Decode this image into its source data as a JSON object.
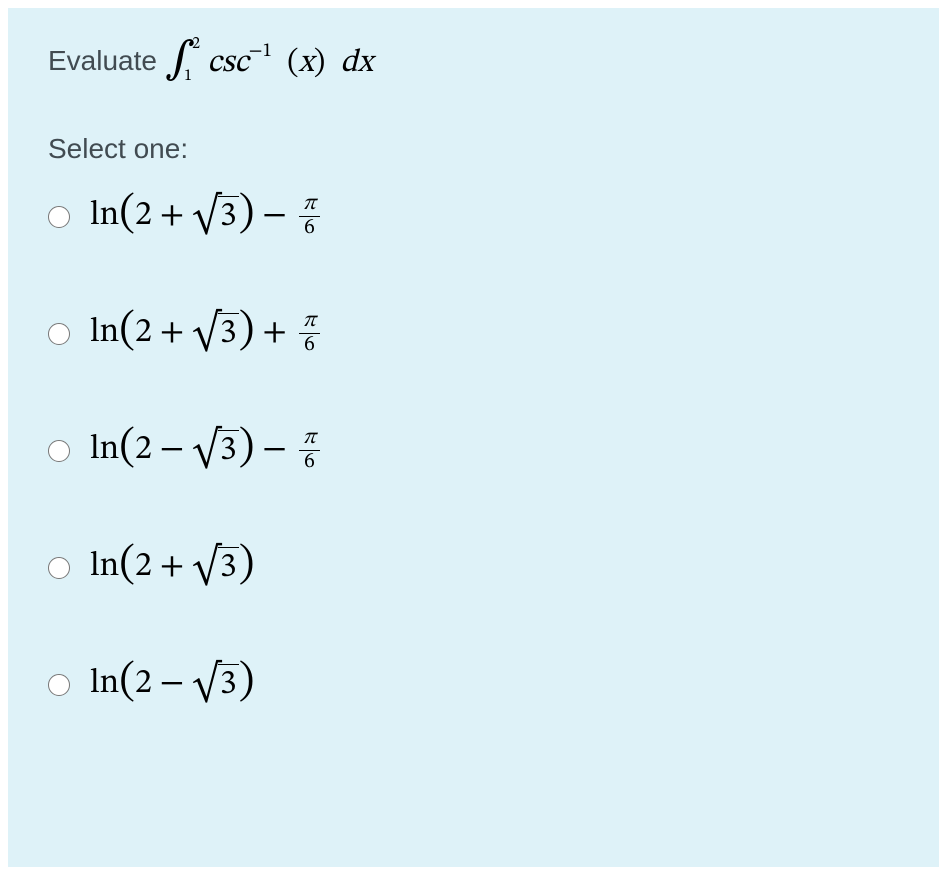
{
  "question": {
    "prefix": "Evaluate ",
    "integral_lower": "1",
    "integral_upper": "2",
    "integrand_func": "csc",
    "integrand_exp": "−1",
    "integrand_arg": "x",
    "differential": "dx"
  },
  "select_label": "Select one:",
  "options": [
    {
      "ln": "ln",
      "inner_num": "2",
      "inner_op": "+",
      "sqrt_arg": "3",
      "tail_op": "−",
      "frac_num": "π",
      "frac_den": "6"
    },
    {
      "ln": "ln",
      "inner_num": "2",
      "inner_op": "+",
      "sqrt_arg": "3",
      "tail_op": "+",
      "frac_num": "π",
      "frac_den": "6"
    },
    {
      "ln": "ln",
      "inner_num": "2",
      "inner_op": "−",
      "sqrt_arg": "3",
      "tail_op": "−",
      "frac_num": "π",
      "frac_den": "6"
    },
    {
      "ln": "ln",
      "inner_num": "2",
      "inner_op": "+",
      "sqrt_arg": "3",
      "tail_op": "",
      "frac_num": "",
      "frac_den": ""
    },
    {
      "ln": "ln",
      "inner_num": "2",
      "inner_op": "−",
      "sqrt_arg": "3",
      "tail_op": "",
      "frac_num": "",
      "frac_den": ""
    }
  ]
}
